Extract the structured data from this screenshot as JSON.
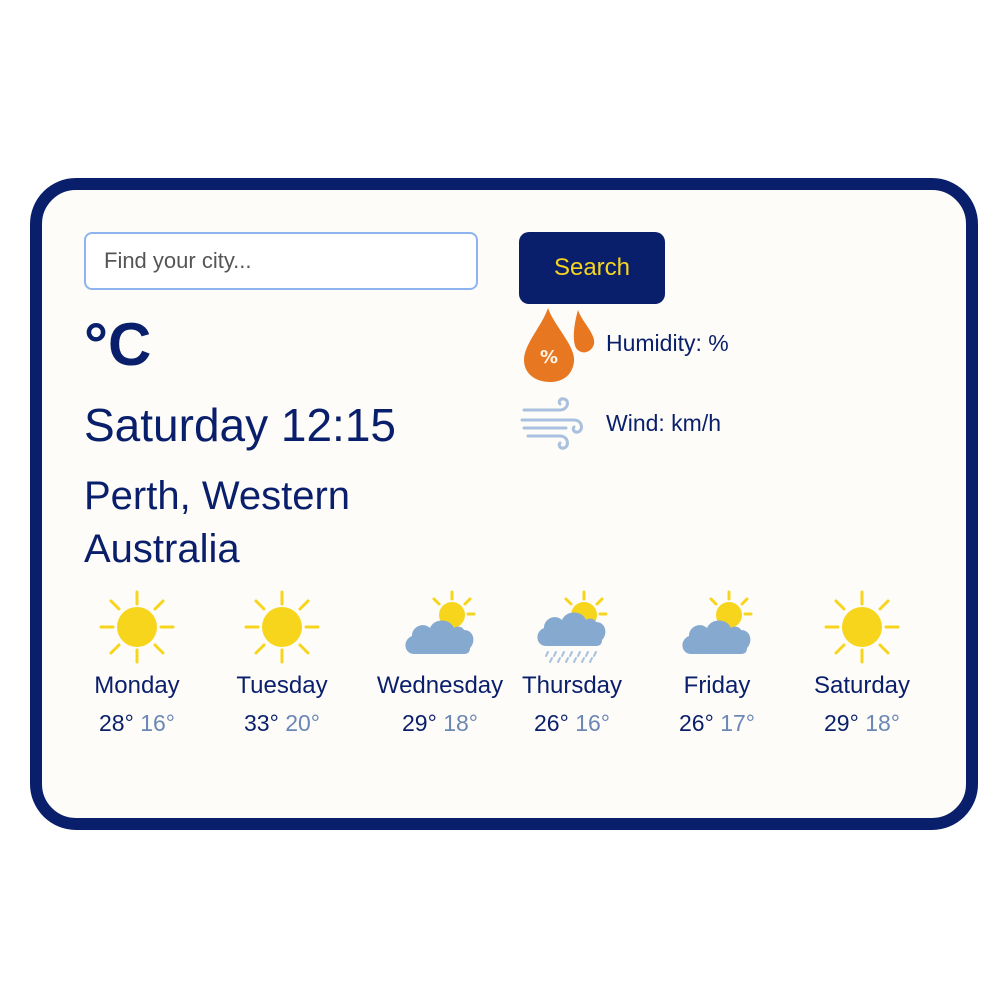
{
  "search": {
    "placeholder": "Find your city...",
    "value": "",
    "button_label": "Search"
  },
  "current": {
    "temp_unit": "°C",
    "datetime": "Saturday 12:15",
    "location": "Perth, Western Australia",
    "humidity_label": "Humidity: %",
    "wind_label": "Wind: km/h",
    "humidity_icon": "humidity-drop-icon",
    "wind_icon": "wind-icon"
  },
  "forecast": [
    {
      "day": "Monday",
      "high": "28°",
      "low": "16°",
      "icon": "sunny-icon"
    },
    {
      "day": "Tuesday",
      "high": "33°",
      "low": "20°",
      "icon": "sunny-icon"
    },
    {
      "day": "Wednesday",
      "high": "29°",
      "low": "18°",
      "icon": "partly-cloudy-icon"
    },
    {
      "day": "Thursday",
      "high": "26°",
      "low": "16°",
      "icon": "rain-icon"
    },
    {
      "day": "Friday",
      "high": "26°",
      "low": "17°",
      "icon": "partly-cloudy-icon"
    },
    {
      "day": "Saturday",
      "high": "29°",
      "low": "18°",
      "icon": "sunny-icon"
    }
  ],
  "colors": {
    "primary": "#0a1f6b",
    "accent": "#f7d51d",
    "humidity": "#e87722",
    "cloud": "#86a9d0",
    "low_temp": "#6b87b5"
  }
}
